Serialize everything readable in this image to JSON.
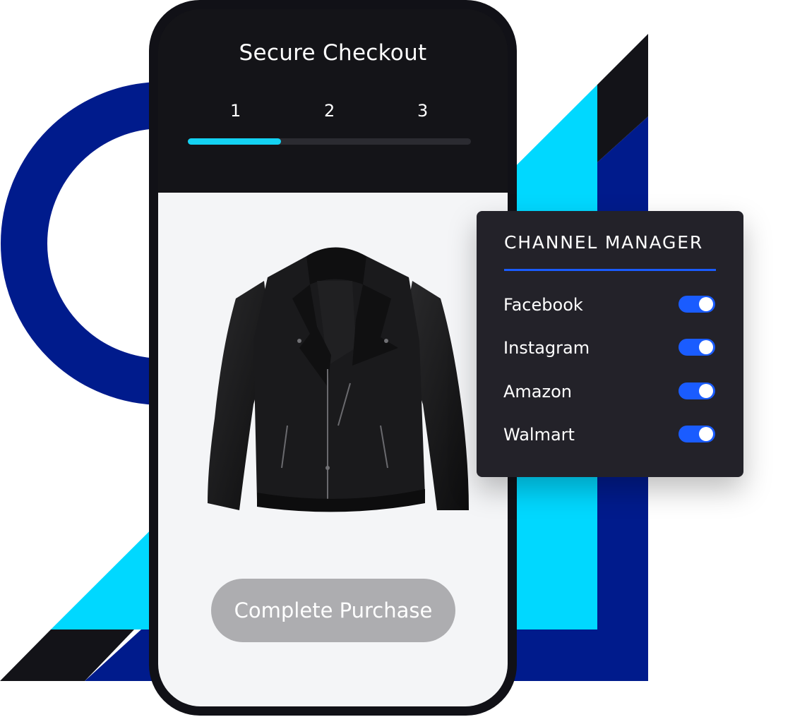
{
  "checkout": {
    "title": "Secure Checkout",
    "steps": [
      "1",
      "2",
      "3"
    ],
    "progress": 0.33,
    "product_image": "leather-jacket",
    "cta_label": "Complete Purchase"
  },
  "channel_manager": {
    "title": "CHANNEL MANAGER",
    "channels": [
      {
        "label": "Facebook",
        "enabled": true
      },
      {
        "label": "Instagram",
        "enabled": true
      },
      {
        "label": "Amazon",
        "enabled": true
      },
      {
        "label": "Walmart",
        "enabled": true
      }
    ]
  },
  "colors": {
    "accent": "#1a5cff",
    "progress": "#14d2f2",
    "navy": "#001b8c",
    "cyan": "#00d8ff",
    "dark": "#111117",
    "button_disabled": "#adadb0"
  }
}
